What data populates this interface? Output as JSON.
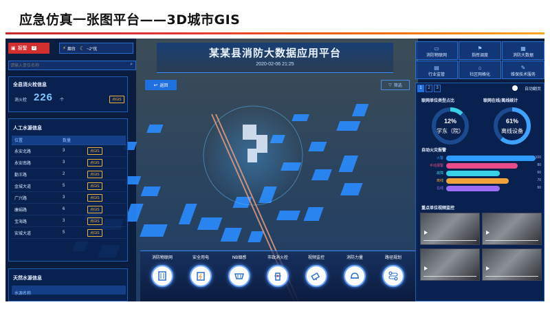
{
  "slide": {
    "title": "应急仿真一张图平台——3D城市GIS"
  },
  "topbar": {
    "alarm_label": "报警",
    "alarm_count": "0",
    "smoke_label": "烟台",
    "weather": "~2°优"
  },
  "search": {
    "placeholder": "请输入单位名称"
  },
  "header": {
    "title": "某某县消防大数据应用平台",
    "datetime": "2020-02-06 21:25"
  },
  "map_controls": {
    "back_label": "返回",
    "filter_label": "筛选"
  },
  "hydrant": {
    "title": "全县消火栓信息",
    "count_label": "消火栓",
    "count": "226",
    "unit": "个",
    "gis_label": "点GIS"
  },
  "water_sources": {
    "title": "人工水源信息",
    "columns": [
      "位置",
      "数量"
    ],
    "rows": [
      {
        "name": "永安北路",
        "count": "3",
        "gis": "点GIS"
      },
      {
        "name": "永安南路",
        "count": "3",
        "gis": "点GIS"
      },
      {
        "name": "勤王路",
        "count": "2",
        "gis": "点GIS"
      },
      {
        "name": "金城大道",
        "count": "5",
        "gis": "点GIS"
      },
      {
        "name": "广兴路",
        "count": "3",
        "gis": "点GIS"
      },
      {
        "name": "康娟路",
        "count": "6",
        "gis": "点GIS"
      },
      {
        "name": "宝海路",
        "count": "3",
        "gis": "点GIS"
      },
      {
        "name": "安城大道",
        "count": "5",
        "gis": "点GIS"
      }
    ]
  },
  "natural_water": {
    "title": "天然水源信息",
    "column": "水源名称"
  },
  "right_nav": [
    {
      "label": "消防物联网",
      "icon": "monitor-icon"
    },
    {
      "label": "指挥调度",
      "icon": "command-icon"
    },
    {
      "label": "消防大数据",
      "icon": "grid-icon"
    },
    {
      "label": "行业监管",
      "icon": "doc-icon"
    },
    {
      "label": "社区网格化",
      "icon": "community-icon"
    },
    {
      "label": "维保技术服务",
      "icon": "wrench-icon"
    }
  ],
  "pager": {
    "pages": [
      "1",
      "2",
      "3"
    ],
    "auto_flip": "自动翻页"
  },
  "stats": {
    "left_title": "联网单位类型占比",
    "right_title": "联网在线/离线统计",
    "left_percent": "12%",
    "left_label": "学东（院）",
    "right_percent": "61%",
    "right_label": "离线设备",
    "left_fraction": 0.12,
    "right_fraction": 0.61
  },
  "alarm_bars": {
    "title": "自动火灾报警",
    "rows": [
      {
        "label": "火警",
        "value": 100,
        "color": "#2f9bff"
      },
      {
        "label": "手动报警",
        "value": 80,
        "color": "#e84d8a"
      },
      {
        "label": "故障",
        "value": 60,
        "color": "#38d1e6"
      },
      {
        "label": "离线",
        "value": 70,
        "color": "#f0a33a"
      },
      {
        "label": "在线",
        "value": 60,
        "color": "#9b6cf5"
      }
    ]
  },
  "video": {
    "title": "重点单位视频监控"
  },
  "toolbar": [
    {
      "label": "消防物联网",
      "icon": "building-icon"
    },
    {
      "label": "安全用电",
      "icon": "battery-icon"
    },
    {
      "label": "NB烟感",
      "icon": "smoke-sensor-icon"
    },
    {
      "label": "市政消火栓",
      "icon": "hydrant-icon"
    },
    {
      "label": "视频监控",
      "icon": "camera-icon"
    },
    {
      "label": "消防力量",
      "icon": "helmet-icon"
    },
    {
      "label": "路径规划",
      "icon": "route-icon"
    }
  ],
  "colors": {
    "accent": "#2a7fff",
    "alarm": "#e53935",
    "gis": "#f0b63a",
    "panel": "#0a2250"
  }
}
